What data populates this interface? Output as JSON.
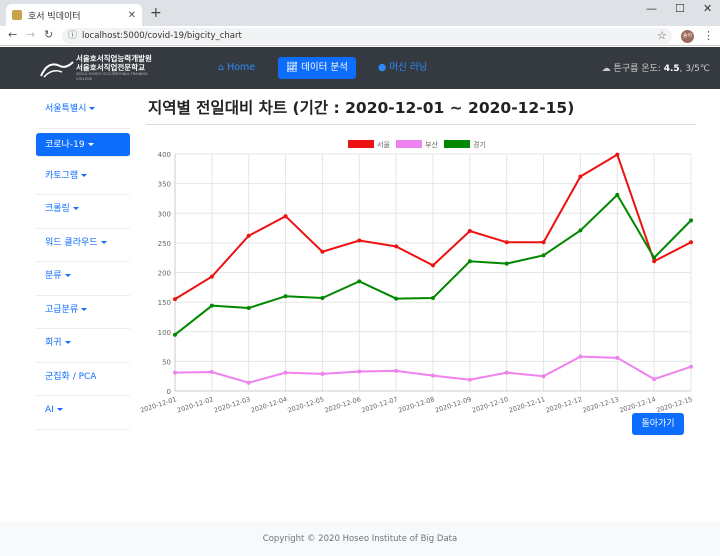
{
  "browser": {
    "tab_title": "호서 빅데이터",
    "url": "localhost:5000/covid-19/bigcity_chart",
    "avatar_text": "송아"
  },
  "navbar": {
    "logo_line1": "서울호서직업능력개발원",
    "logo_line2": "서울호서직업전문학교",
    "logo_sub": "SEOUL HOSEO OCCUPATIONAL TRAINING COLLEGE",
    "links": [
      {
        "label": "Home",
        "icon": "home-icon"
      },
      {
        "label": "데이터 분석",
        "icon": "chart-icon"
      },
      {
        "label": "머신 러닝",
        "icon": "info-icon"
      }
    ],
    "weather_label": "튼구름 온도:",
    "weather_temp": "4.5",
    "weather_range": "3/5℃"
  },
  "sidebar": {
    "items": [
      {
        "label": "서울특별시",
        "dropdown": true
      },
      {
        "label": "코로나-19",
        "dropdown": true,
        "active": true
      },
      {
        "label": "카토그램",
        "dropdown": true
      },
      {
        "label": "크롤링",
        "dropdown": true
      },
      {
        "label": "워드 클라우드",
        "dropdown": true
      },
      {
        "label": "분류",
        "dropdown": true
      },
      {
        "label": "고급분류",
        "dropdown": true
      },
      {
        "label": "회귀",
        "dropdown": true
      },
      {
        "label": "군집화 / PCA",
        "dropdown": false
      },
      {
        "label": "AI",
        "dropdown": true
      }
    ]
  },
  "main": {
    "title": "지역별 전일대비 차트 (기간 : 2020-12-01 ~ 2020-12-15)",
    "back_button": "돌아가기"
  },
  "footer": {
    "text": "Copyright © 2020 Hoseo Institute of Big Data"
  },
  "chart_data": {
    "type": "line",
    "categories": [
      "2020-12-01",
      "2020-12-02",
      "2020-12-03",
      "2020-12-04",
      "2020-12-05",
      "2020-12-06",
      "2020-12-07",
      "2020-12-08",
      "2020-12-09",
      "2020-12-10",
      "2020-12-11",
      "2020-12-12",
      "2020-12-13",
      "2020-12-14",
      "2020-12-15"
    ],
    "series": [
      {
        "name": "서울",
        "color": "#ee1111",
        "values": [
          155,
          193,
          262,
          295,
          235,
          254,
          244,
          212,
          270,
          251,
          251,
          362,
          399,
          219,
          251
        ]
      },
      {
        "name": "부산",
        "color": "#ee82ee",
        "values": [
          31,
          32,
          14,
          31,
          29,
          33,
          34,
          26,
          19,
          31,
          25,
          58,
          56,
          20,
          41
        ]
      },
      {
        "name": "경기",
        "color": "#008800",
        "values": [
          95,
          144,
          140,
          160,
          157,
          185,
          156,
          157,
          219,
          215,
          229,
          271,
          331,
          225,
          288
        ]
      }
    ],
    "ylim": [
      0,
      400
    ],
    "yticks": [
      0,
      50,
      100,
      150,
      200,
      250,
      300,
      350,
      400
    ],
    "grid": true,
    "legend": "top-center"
  }
}
